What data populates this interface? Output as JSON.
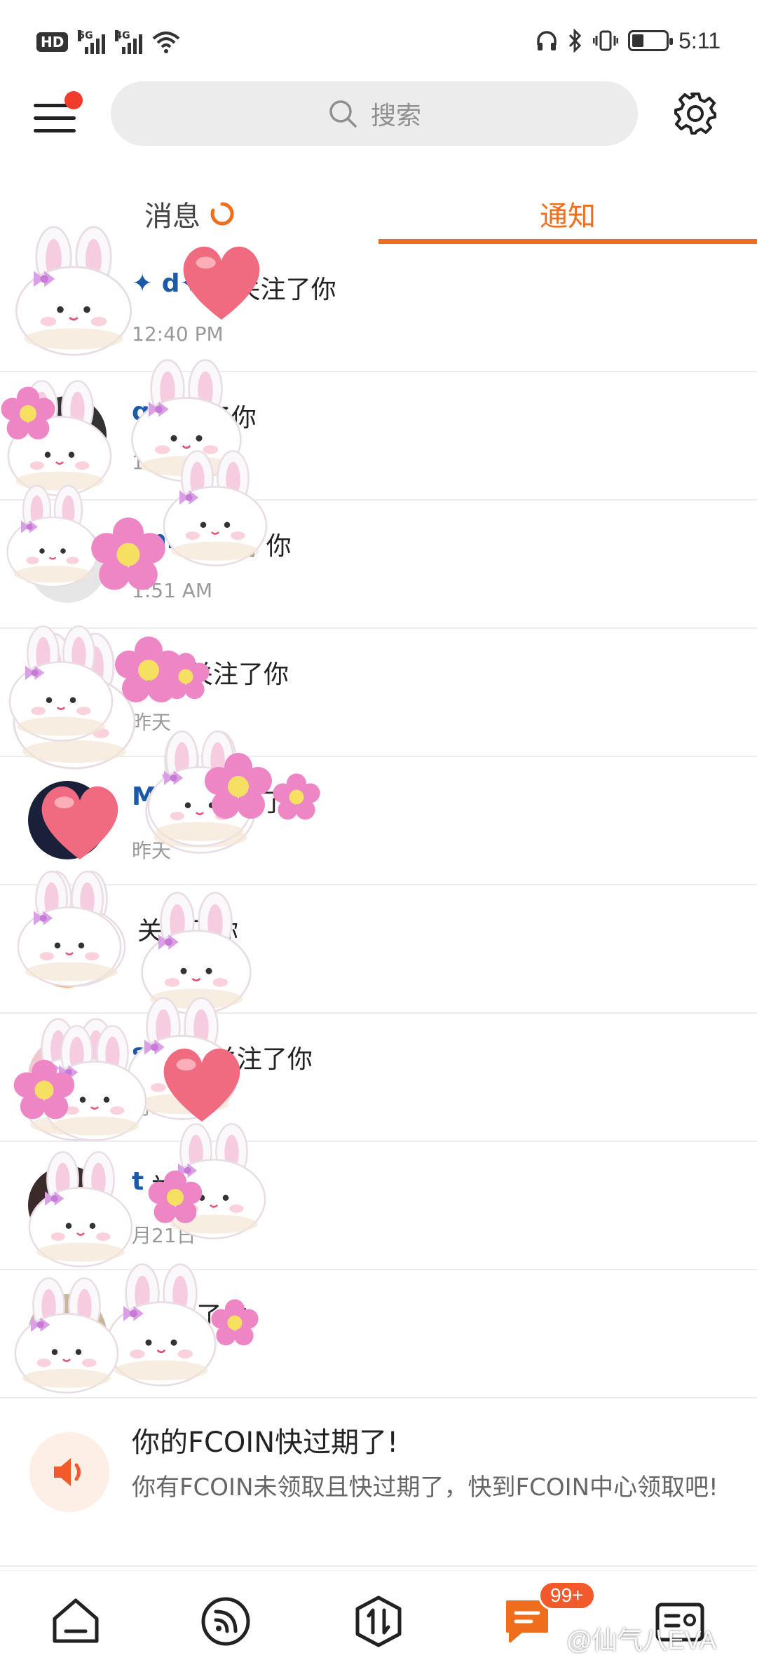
{
  "status_bar": {
    "hd": "HD",
    "net1": "5G",
    "net2": "4G",
    "time": "5:11",
    "battery_level": 0.35
  },
  "header": {
    "search_placeholder": "搜索"
  },
  "tabs": [
    {
      "label": "消息",
      "active": false
    },
    {
      "label": "通知",
      "active": true
    }
  ],
  "notifications": [
    {
      "user": "✦ d✦...",
      "action": "关注了你",
      "time": "12:40 PM",
      "avatar_color": "#d9d9d9"
    },
    {
      "user": "q",
      "action": "关注了你",
      "time": "10",
      "avatar_color": "#333333"
    },
    {
      "user": "ann",
      "action": "关注了你",
      "time": "1:51 AM",
      "avatar_color": "#e6e6e6"
    },
    {
      "user": "青地",
      "action": "关注了你",
      "time": "昨天",
      "avatar_color": "#ee6e1d"
    },
    {
      "user": "M...X",
      "action": "关注了你",
      "time": "昨天",
      "avatar_color": "#1a1f3a"
    },
    {
      "user": "",
      "action": "关注了你",
      "time": "",
      "avatar_color": "#f2a15a"
    },
    {
      "user": "ster1",
      "action": "关注了你",
      "time": "月21日",
      "avatar_color": "#f0c8d0"
    },
    {
      "user": "t",
      "action": "关注了你",
      "time": "月21日",
      "avatar_color": "#3a2a2a"
    },
    {
      "user": "l",
      "action": "关注了你",
      "time": "",
      "avatar_color": "#c9b79a"
    }
  ],
  "fcoin": {
    "title": "你的FCOIN快过期了!",
    "body": "你有FCOIN未领取且快过期了，快到FCOIN中心领取吧!"
  },
  "bottom_nav": {
    "badge": "99+",
    "watermark": "@仙气八EVA"
  },
  "colors": {
    "accent": "#ee6e1d",
    "link": "#1b5aa8",
    "red_dot": "#f23c2b"
  }
}
